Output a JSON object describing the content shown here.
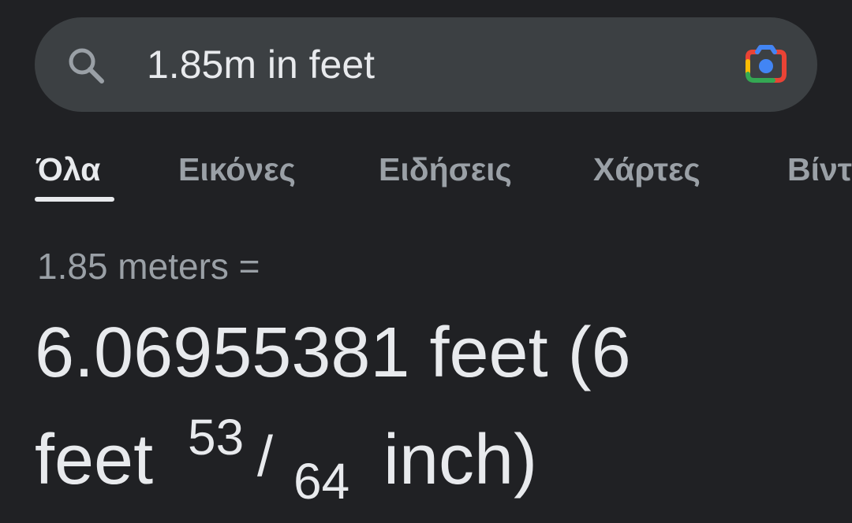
{
  "search": {
    "query": "1.85m in feet",
    "icon_search": "search-icon",
    "icon_lens": "google-lens-icon"
  },
  "tabs": [
    {
      "label": "Όλα",
      "active": true
    },
    {
      "label": "Εικόνες",
      "active": false
    },
    {
      "label": "Ειδήσεις",
      "active": false
    },
    {
      "label": "Χάρτες",
      "active": false
    },
    {
      "label": "Βίντ",
      "active": false
    }
  ],
  "conversion": {
    "query_text": "1.85 meters =",
    "result_main": "6.06955381 feet (6",
    "result_line2_prefix": "feet",
    "fraction_numerator": "53",
    "fraction_slash": "/",
    "fraction_denominator": "64",
    "result_line2_suffix": "inch)"
  },
  "colors": {
    "background": "#202124",
    "search_bar": "#3c4043",
    "text_primary": "#e8eaed",
    "text_secondary": "#9aa0a6",
    "lens_blue": "#4285f4",
    "lens_red": "#ea4335",
    "lens_yellow": "#fbbc04",
    "lens_green": "#34a853"
  }
}
